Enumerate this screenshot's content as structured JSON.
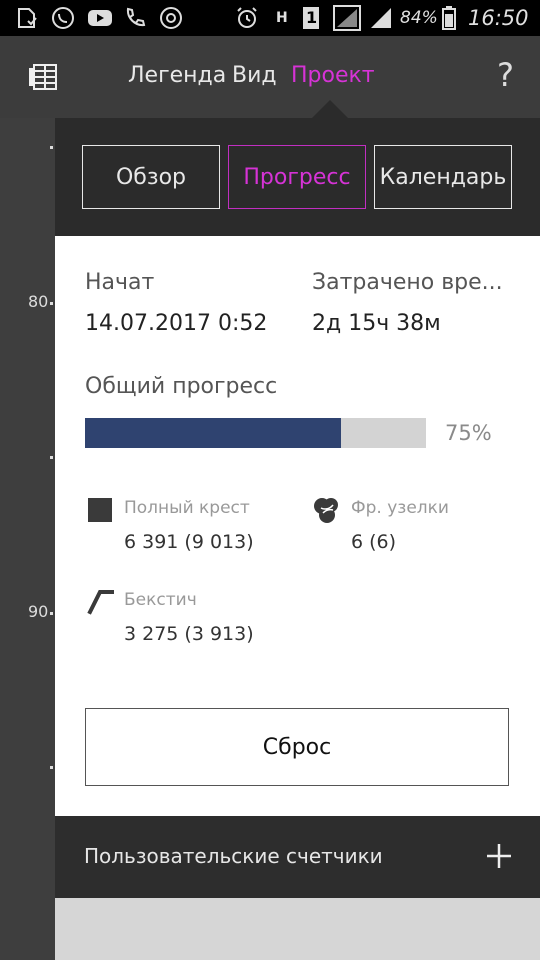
{
  "status_bar": {
    "battery": "84%",
    "time": "16:50",
    "sim_label": "1",
    "network_label": "H"
  },
  "nav": {
    "legend": "Легенда",
    "view": "Вид",
    "project": "Проект",
    "help": "?"
  },
  "axis_labels": [
    "80",
    "90"
  ],
  "tabs": {
    "overview": "Обзор",
    "progress": "Прогресс",
    "calendar": "Календарь"
  },
  "progress_panel": {
    "started_label": "Начат",
    "started_value": "14.07.2017 0:52",
    "time_spent_label": "Затрачено вре...",
    "time_spent_value": "2д 15ч 38м",
    "overall_label": "Общий прогресс",
    "overall_percent": 75,
    "overall_percent_text": "75%"
  },
  "stats": {
    "full_cross_label": "Полный крест",
    "full_cross_value": "6 391 (9 013)",
    "french_knots_label": "Фр. узелки",
    "french_knots_value": "6 (6)",
    "backstitch_label": "Бекстич",
    "backstitch_value": "3 275 (3 913)"
  },
  "reset_label": "Сброс",
  "custom_counters_label": "Пользовательские счетчики",
  "colors": {
    "accent": "#d633d6",
    "progress_fill": "#2f4370"
  }
}
